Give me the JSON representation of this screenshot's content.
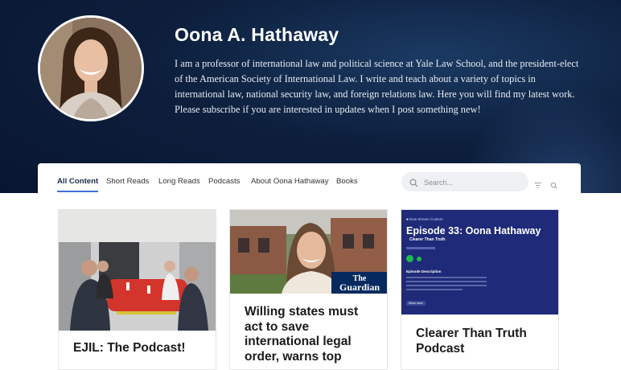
{
  "profile": {
    "name": "Oona A. Hathaway",
    "bio": "I am a professor of international law and political science at Yale Law School, and the president-elect of the American Society of International Law.  I write and teach about a variety of topics in international law, national security law, and foreign relations law. Here you will find my latest work. Please subscribe if you are interested in updates when I post something new!"
  },
  "tabs": [
    {
      "label": "All Content",
      "active": true
    },
    {
      "label": "Short Reads",
      "active": false
    },
    {
      "label": "Long Reads",
      "active": false
    },
    {
      "label": "Podcasts",
      "active": false
    },
    {
      "label": "About Oona Hathaway",
      "active": false
    },
    {
      "label": "Books",
      "active": false
    }
  ],
  "search": {
    "placeholder": "Search..."
  },
  "cards": [
    {
      "title": "EJIL: The Podcast!"
    },
    {
      "title": "Willing states must act to save international legal order, warns top",
      "badge_line1": "The",
      "badge_line2": "Guardian"
    },
    {
      "title": "Clearer Than Truth Podcast",
      "podcast": {
        "network": "■ Now Stream Custom",
        "episode_title": "Episode 33: Oona Hathaway",
        "show": "Clearer Than Truth",
        "section": "Episode Description",
        "button": "Show more"
      }
    }
  ],
  "colors": {
    "hero": "#0d1f3d",
    "accent": "#3f6fd8",
    "podcast_bg": "#1f2a78"
  }
}
